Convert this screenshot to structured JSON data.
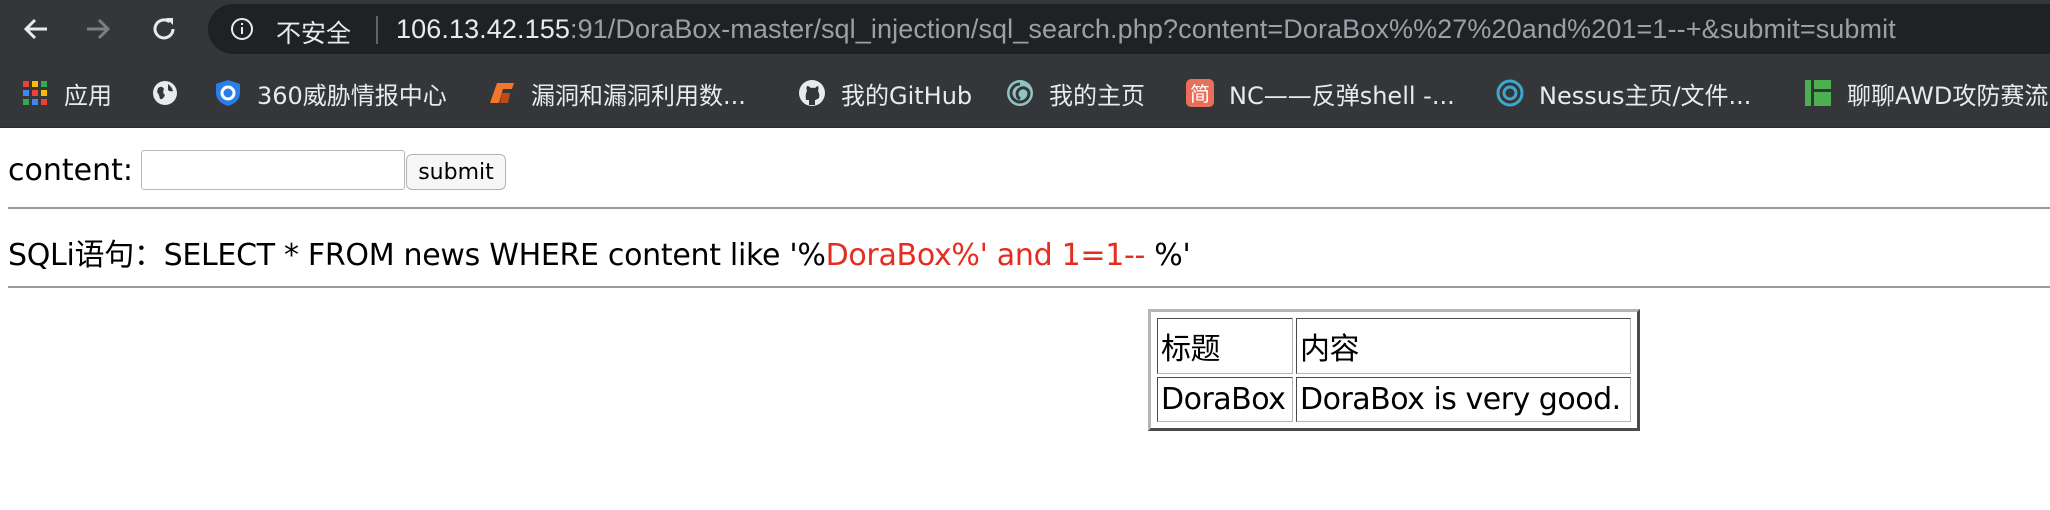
{
  "browser": {
    "security_label": "不安全",
    "url_host": "106.13.42.155",
    "url_rest": ":91/DoraBox-master/sql_injection/sql_search.php?content=DoraBox%%27%20and%201=1--+&submit=submit"
  },
  "bookmarks": [
    {
      "label": "应用",
      "icon": "apps-grid-icon"
    },
    {
      "label": "",
      "icon": "globe-icon"
    },
    {
      "label": "360威胁情报中心",
      "icon": "360-shield-icon"
    },
    {
      "label": "漏洞和漏洞利用数...",
      "icon": "exploit-db-icon"
    },
    {
      "label": "我的GitHub",
      "icon": "github-icon"
    },
    {
      "label": "我的主页",
      "icon": "swirl-icon"
    },
    {
      "label": "NC——反弹shell -...",
      "icon": "jianshu-icon"
    },
    {
      "label": "Nessus主页/文件...",
      "icon": "nessus-icon"
    },
    {
      "label": "聊聊AWD攻防赛流",
      "icon": "bars-icon"
    }
  ],
  "form": {
    "label": "content:",
    "input_value": "",
    "submit_label": "submit"
  },
  "sql": {
    "prefix": "SQLi语句：SELECT * FROM news WHERE content like '%",
    "injected": "DoraBox%' and 1=1-- ",
    "suffix": "%'"
  },
  "results": {
    "headers": [
      "标题",
      "内容"
    ],
    "rows": [
      [
        "DoraBox",
        "DoraBox is very good."
      ]
    ]
  },
  "colors": {
    "injected_text": "#e52d1f",
    "toolbar_bg": "#35363a"
  }
}
